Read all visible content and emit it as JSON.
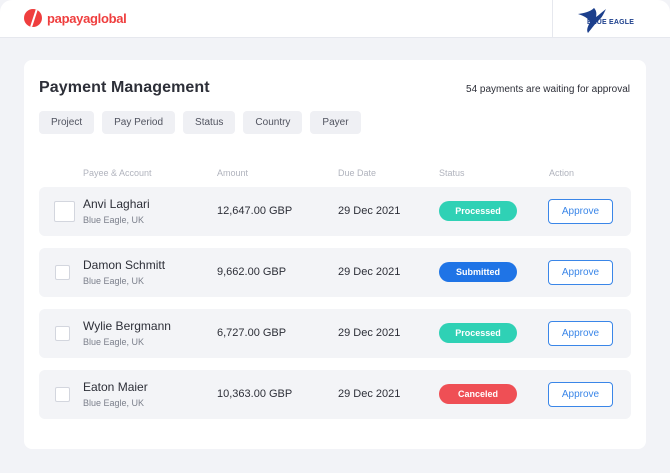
{
  "brand": {
    "name": "papayaglobal"
  },
  "client": {
    "name": "BLUE EAGLE"
  },
  "page": {
    "title": "Payment Management",
    "waiting_text": "54 payments are waiting for approval"
  },
  "filters": [
    "Project",
    "Pay Period",
    "Status",
    "Country",
    "Payer"
  ],
  "columns": {
    "payee": "Payee & Account",
    "amount": "Amount",
    "due": "Due Date",
    "status": "Status",
    "action": "Action"
  },
  "rows": [
    {
      "name": "Anvi Laghari",
      "account": "Blue Eagle, UK",
      "amount": "12,647.00 GBP",
      "due": "29 Dec 2021",
      "status": "Processed",
      "status_color": "#2fd1b5",
      "action": "Approve"
    },
    {
      "name": "Damon Schmitt",
      "account": "Blue Eagle, UK",
      "amount": "9,662.00 GBP",
      "due": "29 Dec 2021",
      "status": "Submitted",
      "status_color": "#1f74e6",
      "action": "Approve"
    },
    {
      "name": "Wylie Bergmann",
      "account": "Blue Eagle, UK",
      "amount": "6,727.00 GBP",
      "due": "29 Dec 2021",
      "status": "Processed",
      "status_color": "#2fd1b5",
      "action": "Approve"
    },
    {
      "name": "Eaton Maier",
      "account": "Blue Eagle, UK",
      "amount": "10,363.00 GBP",
      "due": "29 Dec 2021",
      "status": "Canceled",
      "status_color": "#ef4f55",
      "action": "Approve"
    }
  ]
}
